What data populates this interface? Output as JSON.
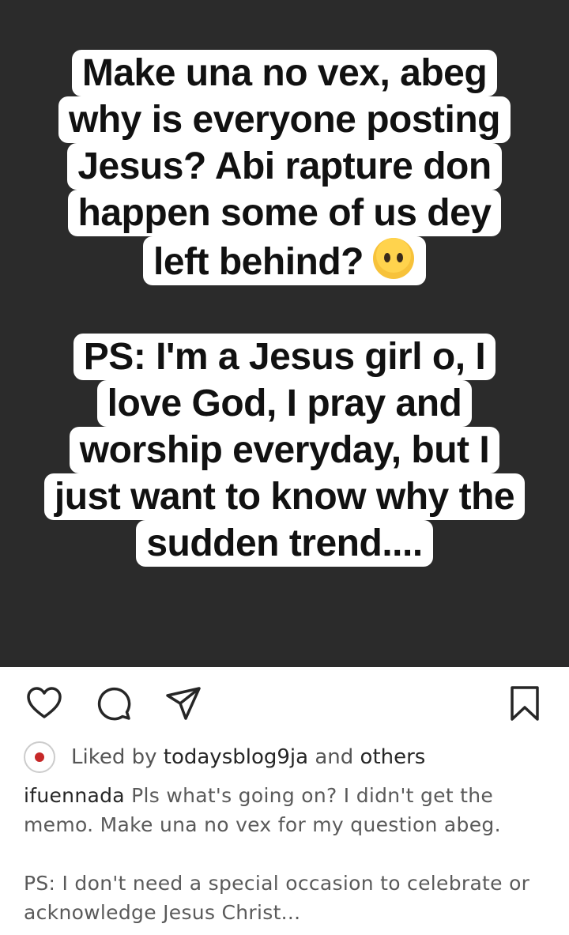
{
  "story": {
    "block1": [
      "Make una no vex, abeg",
      "why is everyone posting",
      "Jesus? Abi rapture don",
      "happen some of us dey",
      "left behind?"
    ],
    "emoji": "neutral-face-emoji",
    "block2": [
      "PS: I'm a Jesus girl o, I",
      "love God, I pray and",
      "worship everyday, but I",
      "just want to know why the",
      "sudden trend...."
    ]
  },
  "actions": {
    "icons": [
      "heart-icon",
      "comment-icon",
      "share-icon",
      "bookmark-icon"
    ]
  },
  "likes": {
    "prefix": "Liked by",
    "user": "todaysblog9ja",
    "conjunction": "and",
    "others": "others"
  },
  "caption": {
    "username": "ifuennada",
    "text1": "Pls what's going on? I didn't get the\nmemo. Make una no vex for my question abeg.",
    "text2": "PS: I don't need a special occasion to celebrate or\nacknowledge Jesus Christ..."
  },
  "colors": {
    "post_background": "#2b2b2b",
    "caption_box": "#ffffff",
    "text": "#262626"
  }
}
